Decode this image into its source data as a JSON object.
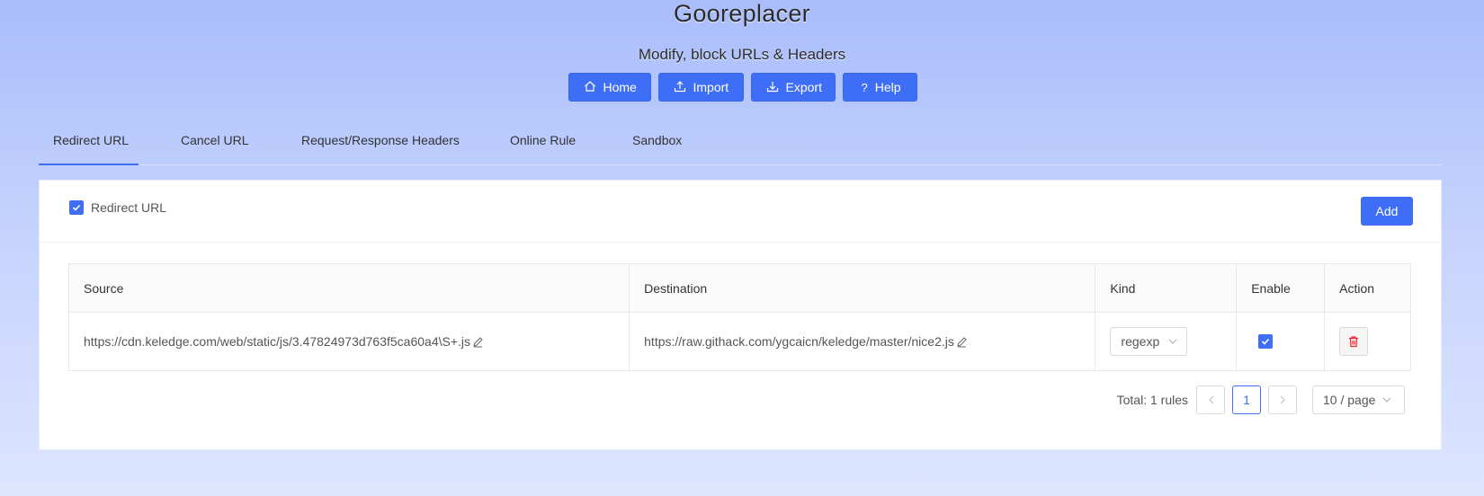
{
  "header": {
    "title": "Gooreplacer",
    "subtitle": "Modify, block URLs & Headers",
    "buttons": {
      "home": "Home",
      "import": "Import",
      "export": "Export",
      "help": "Help"
    }
  },
  "tabs": [
    {
      "label": "Redirect URL",
      "active": true
    },
    {
      "label": "Cancel URL",
      "active": false
    },
    {
      "label": "Request/Response Headers",
      "active": false
    },
    {
      "label": "Online Rule",
      "active": false
    },
    {
      "label": "Sandbox",
      "active": false
    }
  ],
  "panel": {
    "toggle_label": "Redirect URL",
    "toggle_checked": true,
    "add_label": "Add"
  },
  "table": {
    "columns": [
      "Source",
      "Destination",
      "Kind",
      "Enable",
      "Action"
    ],
    "rows": [
      {
        "source": "https://cdn.keledge.com/web/static/js/3.47824973d763f5ca60a4\\S+.js",
        "destination": "https://raw.githack.com/ygcaicn/keledge/master/nice2.js",
        "kind": "regexp",
        "enabled": true
      }
    ]
  },
  "pagination": {
    "total_text": "Total: 1 rules",
    "current_page": "1",
    "page_size": "10 / page"
  },
  "colors": {
    "accent": "#3f6ef6",
    "danger": "#f5222d"
  }
}
